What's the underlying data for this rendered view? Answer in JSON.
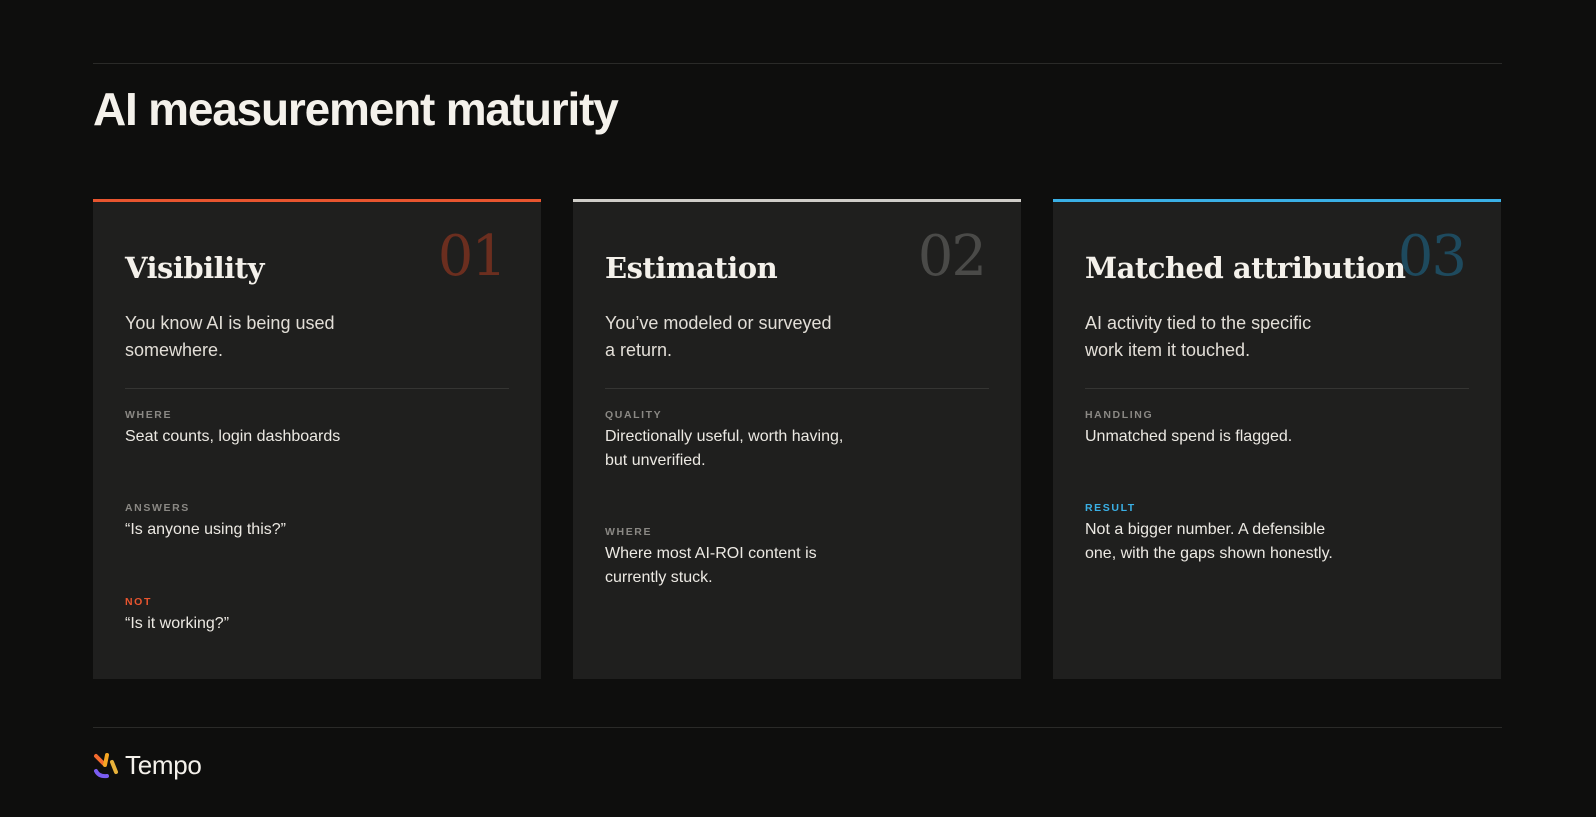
{
  "title": "AI measurement maturity",
  "brand": {
    "name": "Tempo"
  },
  "cards": [
    {
      "number": "01",
      "title": "Visibility",
      "description": "You know AI is being used somewhere.",
      "accent": "#e8552f",
      "number_color": "#6b2e1f",
      "items": [
        {
          "label": "WHERE",
          "text": "Seat counts, login dashboards",
          "label_color": "#8a8884"
        },
        {
          "label": "ANSWERS",
          "text": "“Is anyone using this?”",
          "label_color": "#8a8884"
        },
        {
          "label": "NOT",
          "text": "“Is it working?”",
          "label_color": "#e8552f"
        }
      ]
    },
    {
      "number": "02",
      "title": "Estimation",
      "description": "You’ve modeled or surveyed a return.",
      "accent": "#cfcdc8",
      "number_color": "#4a4a48",
      "items": [
        {
          "label": "QUALITY",
          "text": "Directionally useful, worth having, but unverified.",
          "label_color": "#8a8884"
        },
        {
          "label": "WHERE",
          "text": "Where most AI-ROI content is currently stuck.",
          "label_color": "#8a8884"
        }
      ]
    },
    {
      "number": "03",
      "title": "Matched attribution",
      "description": "AI activity tied to the specific work item it touched.",
      "accent": "#3ab0e6",
      "number_color": "#1e4a5e",
      "items": [
        {
          "label": "HANDLING",
          "text": "Unmatched spend is flagged.",
          "label_color": "#8a8884"
        },
        {
          "label": "RESULT",
          "text": "Not a bigger number. A defensible one, with the gaps shown honestly.",
          "label_color": "#3ab0e6"
        }
      ]
    }
  ]
}
